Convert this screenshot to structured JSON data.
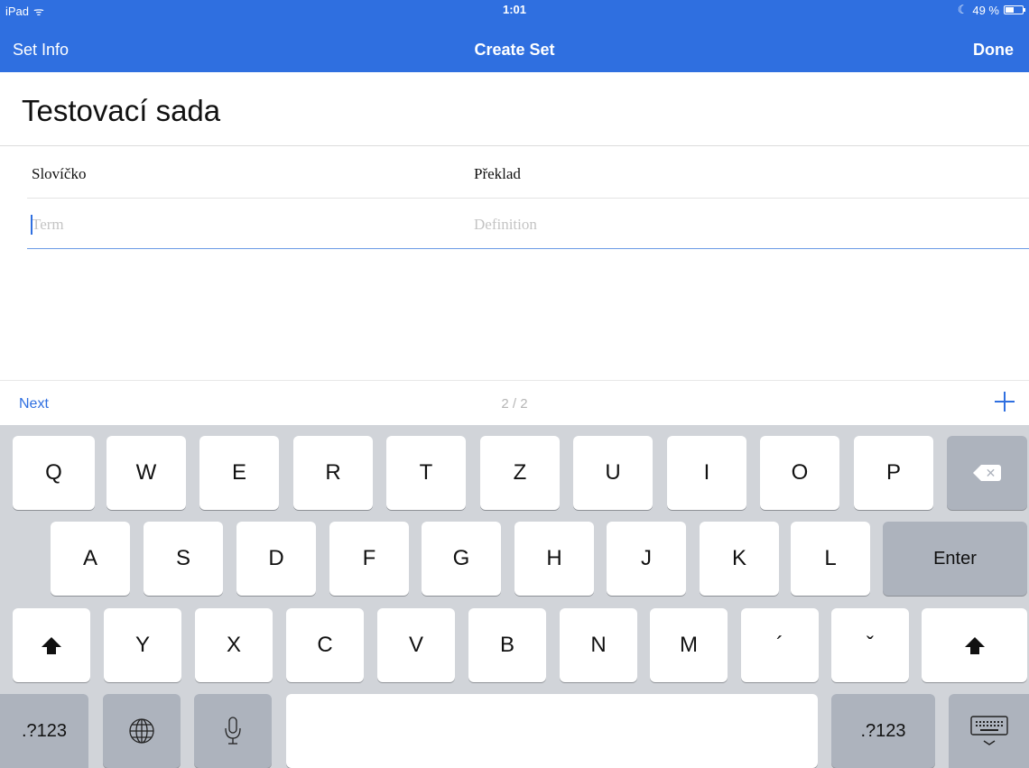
{
  "status_bar": {
    "device": "iPad",
    "time": "1:01",
    "battery": "49 %",
    "moon": "☾",
    "wifi": "ᯤ"
  },
  "nav": {
    "left": "Set Info",
    "title": "Create Set",
    "right": "Done"
  },
  "set": {
    "title": "Testovací sada",
    "term_label": "Slovíčko",
    "definition_label": "Překlad",
    "term_placeholder": "Term",
    "definition_placeholder": "Definition"
  },
  "toolbar": {
    "next": "Next",
    "counter": "2 / 2"
  },
  "keyboard": {
    "row1": [
      "Q",
      "W",
      "E",
      "R",
      "T",
      "Z",
      "U",
      "I",
      "O",
      "P"
    ],
    "row2": [
      "A",
      "S",
      "D",
      "F",
      "G",
      "H",
      "J",
      "K",
      "L"
    ],
    "row2_enter": "Enter",
    "row3": [
      "Y",
      "X",
      "C",
      "V",
      "B",
      "N",
      "M",
      "´",
      "ˇ"
    ],
    "row4_left": ".?123",
    "row4_right": ".?123",
    "globe": "🌐",
    "mic": "🎙",
    "hide": "⌨"
  }
}
